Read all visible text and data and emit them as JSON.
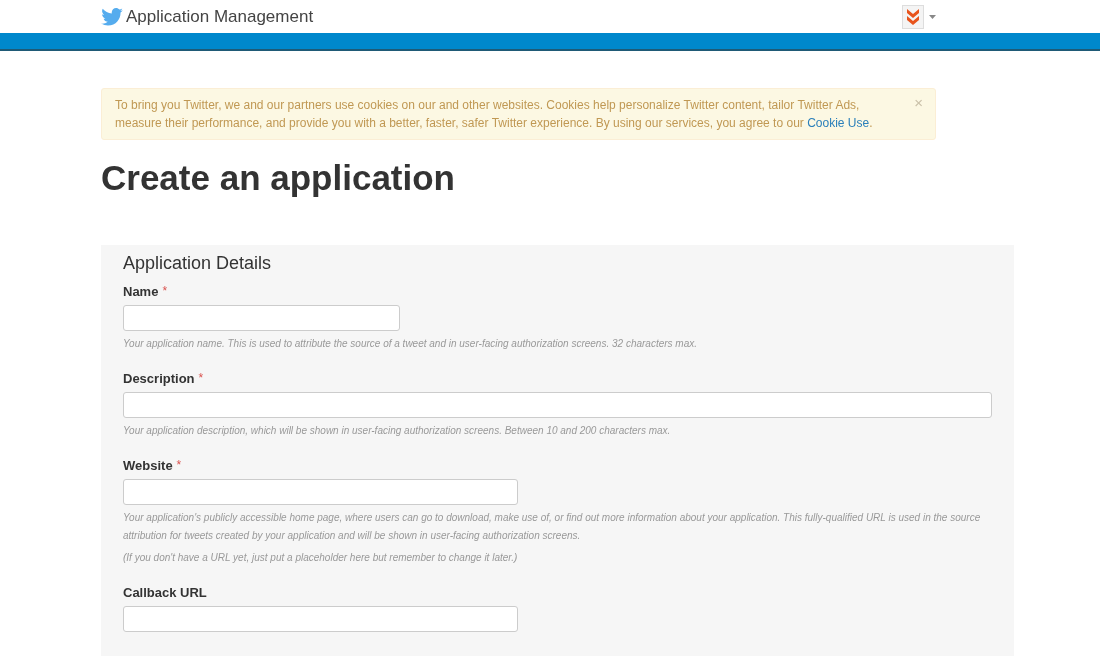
{
  "header": {
    "title": "Application Management"
  },
  "cookie_notice": {
    "text": "To bring you Twitter, we and our partners use cookies on our and other websites. Cookies help personalize Twitter content, tailor Twitter Ads, measure their performance, and provide you with a better, faster, safer Twitter experience. By using our services, you agree to our",
    "link": "Cookie Use",
    "after": ".",
    "close": "×"
  },
  "page_title": "Create an application",
  "panel": {
    "title": "Application Details",
    "required_mark": "*",
    "fields": [
      {
        "label": "Name",
        "required": true,
        "kind": "short",
        "help": [
          "Your application name. This is used to attribute the source of a tweet and in user-facing authorization screens. 32 characters max."
        ]
      },
      {
        "label": "Description",
        "required": true,
        "kind": "wide",
        "help": [
          "Your application description, which will be shown in user-facing authorization screens. Between 10 and 200 characters max."
        ]
      },
      {
        "label": "Website",
        "required": true,
        "kind": "medium",
        "help": [
          "Your application's publicly accessible home page, where users can go to download, make use of, or find out more information about your application. This fully-qualified URL is used in the source attribution for tweets created by your application and will be shown in user-facing authorization screens.",
          "(If you don't have a URL yet, just put a placeholder here but remember to change it later.)"
        ]
      },
      {
        "label": "Callback URL",
        "required": false,
        "kind": "medium"
      }
    ]
  }
}
